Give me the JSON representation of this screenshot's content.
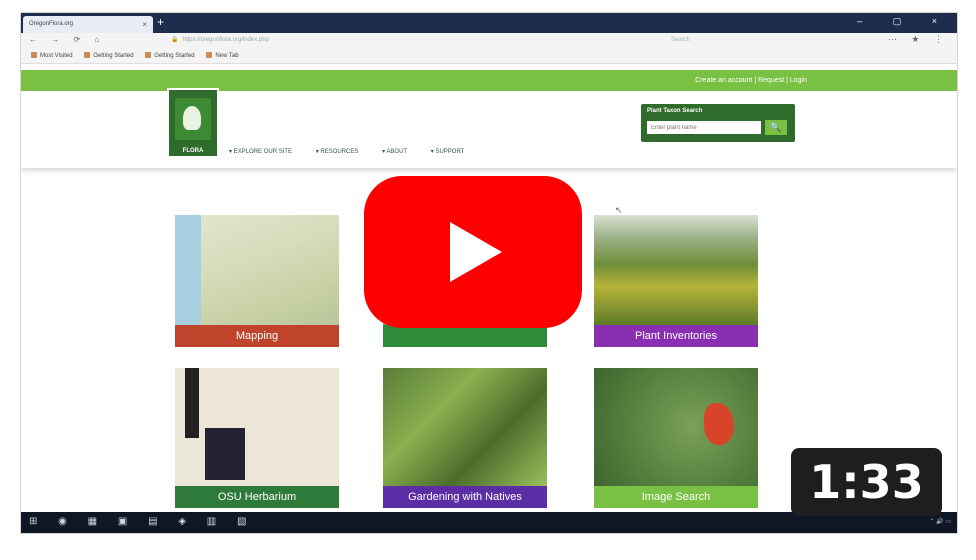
{
  "browser": {
    "tab_title": "OregonFlora.org",
    "tab_close": "×",
    "new_tab": "+",
    "window_controls": "– ▢ ×",
    "nav_icons": "← → ⟳ ⌂",
    "url": "https://oregonflora.org/index.php",
    "lock": "🔒",
    "search_placeholder": "Search",
    "toolbar_icons": "⋯ ★ ⋮",
    "bookmarks": [
      "Most Visited",
      "Getting Started",
      "Getting Started",
      "New Tab"
    ]
  },
  "site": {
    "account_links": "Create an account | Request | Login",
    "logo_word": "FLORA",
    "nav": [
      "▾ EXPLORE OUR SITE",
      "▾ RESOURCES",
      "▾ ABOUT",
      "▾ SUPPORT"
    ],
    "plant_search": {
      "label": "Plant Taxon Search",
      "placeholder": "Enter plant name",
      "button_icon": "🔍"
    }
  },
  "tiles": {
    "mapping": "Mapping",
    "middle": "",
    "plant_inventories": "Plant Inventories",
    "herbarium": "OSU Herbarium",
    "gardening": "Gardening with Natives",
    "image_search": "Image Search"
  },
  "video": {
    "duration": "1:33"
  },
  "taskbar": {
    "icons": "⊞ ◉ ▦ ▣ ▤ ◈ ▥ ▧",
    "tray": "⌃ 🔊 ▭"
  },
  "colors": {
    "green": "#7ac143",
    "dark_green": "#2f6b2a",
    "youtube_red": "#ff0000"
  }
}
